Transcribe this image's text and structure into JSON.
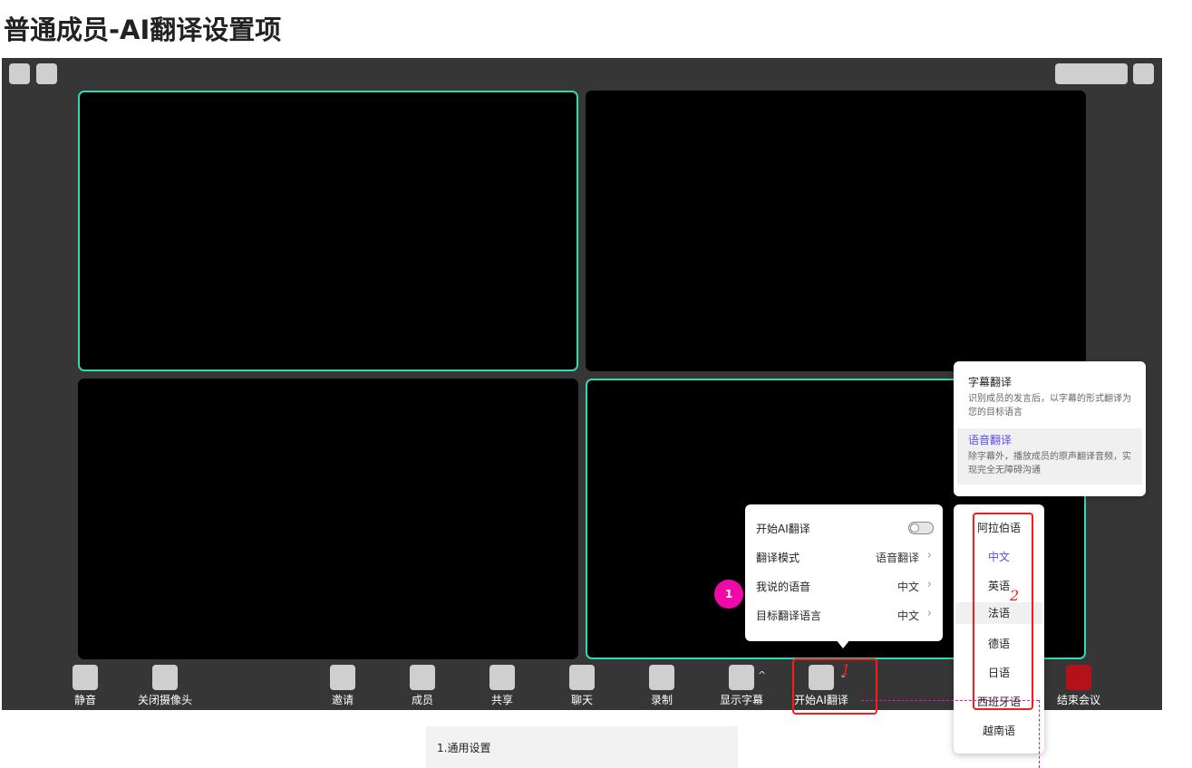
{
  "page_title": "普通成员-AI翻译设置项",
  "toolbar": {
    "mute": "静音",
    "camera_off": "关闭摄像头",
    "invite": "邀请",
    "members": "成员",
    "share": "共享",
    "chat": "聊天",
    "record": "录制",
    "show_subtitles": "显示字幕",
    "start_ai_translation": "开始AI翻译",
    "end_meeting": "结束会议"
  },
  "settings_popup": {
    "toggle_label": "开始AI翻译",
    "toggle_on": false,
    "mode_label": "翻译模式",
    "mode_value": "语音翻译",
    "my_language_label": "我说的语音",
    "my_language_value": "中文",
    "target_language_label": "目标翻译语言",
    "target_language_value": "中文"
  },
  "step_badge": "1",
  "mode_popup": {
    "options": [
      {
        "title": "字幕翻译",
        "desc": "识别成员的发言后，以字幕的形式翻译为您的目标语言"
      },
      {
        "title": "语音翻译",
        "desc": "除字幕外，播放成员的原声翻译音频，实现完全无障碍沟通"
      }
    ],
    "selected": "语音翻译"
  },
  "language_popup": {
    "items": [
      "阿拉伯语",
      "中文",
      "英语",
      "法语",
      "德语",
      "日语",
      "西班牙语",
      "越南语"
    ],
    "selected": "中文",
    "hovered": "法语"
  },
  "annotations": {
    "num1": "1",
    "num2": "2"
  },
  "section_label": "1.通用设置",
  "colors": {
    "active_border": "#32d9b4",
    "accent": "#5a4df5",
    "badge": "#f008a8",
    "end_button": "#b3111b",
    "annotation_red": "#ff1a1a"
  }
}
